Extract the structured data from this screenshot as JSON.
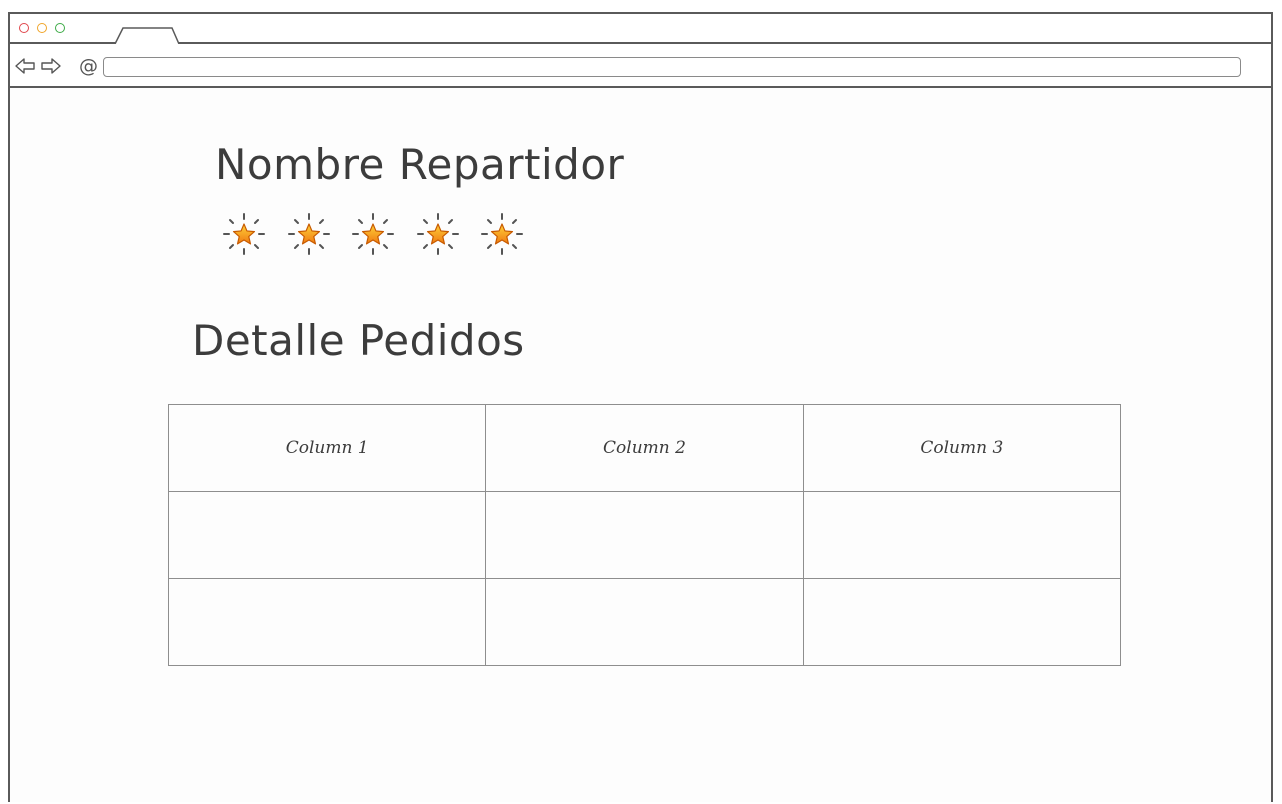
{
  "browser": {
    "url": ""
  },
  "page": {
    "delivery_name_title": "Nombre Repartidor",
    "rating": {
      "value": 5,
      "max": 5,
      "icon": "star-icon",
      "color": "#f5a623"
    },
    "orders_title": "Detalle Pedidos"
  },
  "table": {
    "columns": [
      "Column 1",
      "Column 2",
      "Column 3"
    ],
    "rows": [
      [
        "",
        "",
        ""
      ],
      [
        "",
        "",
        ""
      ]
    ]
  }
}
